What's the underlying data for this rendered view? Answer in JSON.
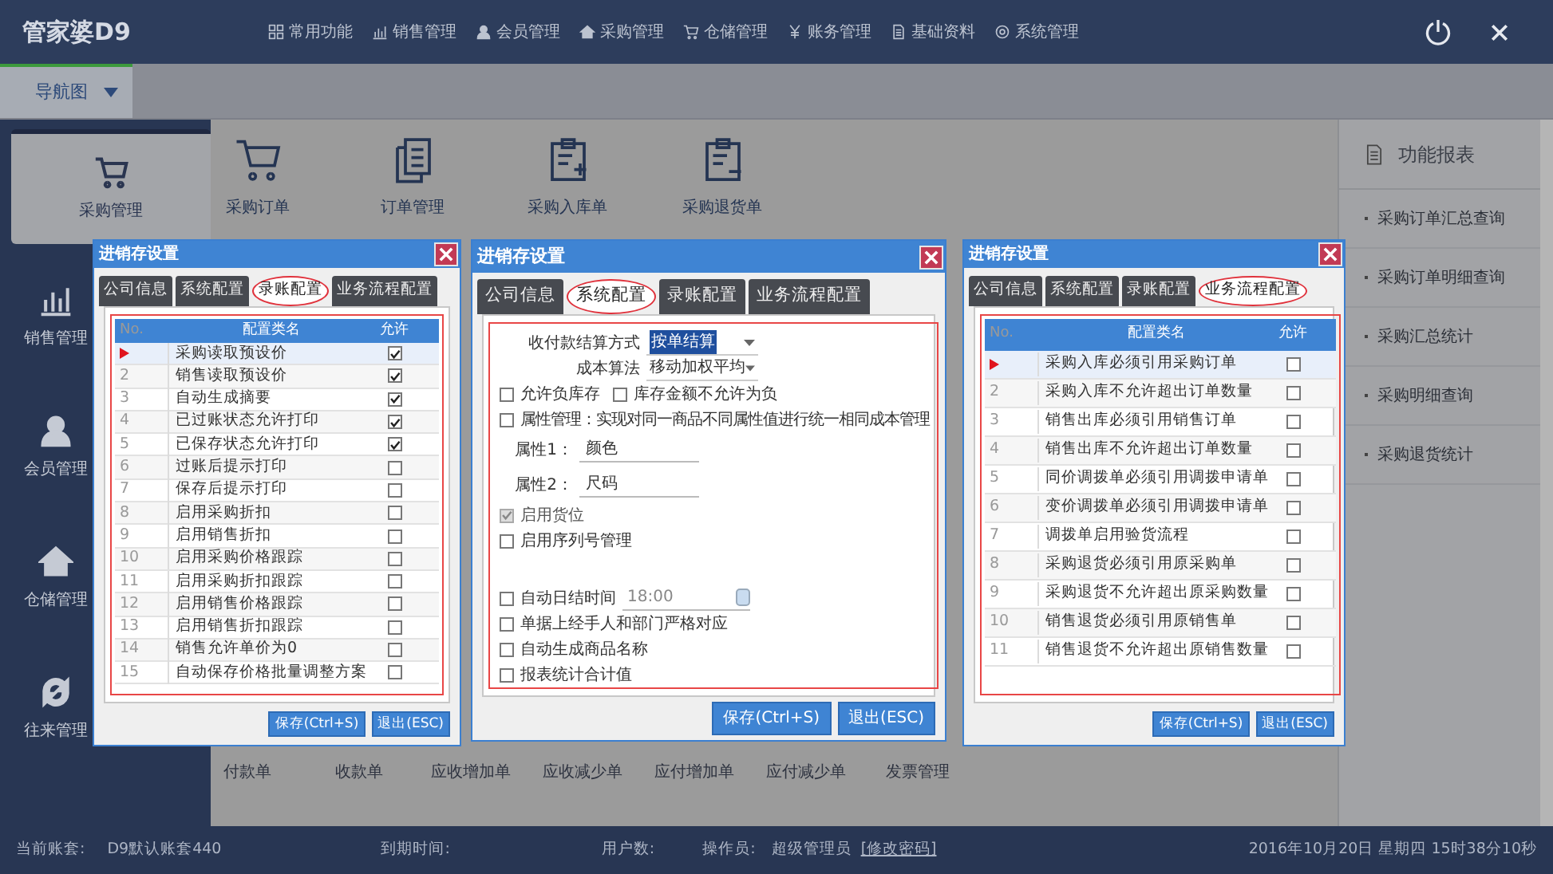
{
  "app": {
    "logo": "管家婆D9",
    "nav_tab": "导航图"
  },
  "menu": [
    {
      "label": "常用功能"
    },
    {
      "label": "销售管理"
    },
    {
      "label": "会员管理"
    },
    {
      "label": "采购管理"
    },
    {
      "label": "仓储管理"
    },
    {
      "label": "账务管理"
    },
    {
      "label": "基础资料"
    },
    {
      "label": "系统管理"
    }
  ],
  "sidebar": [
    {
      "label": "采购管理",
      "selected": true
    },
    {
      "label": "销售管理",
      "selected": false
    },
    {
      "label": "会员管理",
      "selected": false
    },
    {
      "label": "仓储管理",
      "selected": false
    },
    {
      "label": "往来管理",
      "selected": false
    }
  ],
  "toolbar": [
    {
      "label": "采购订单"
    },
    {
      "label": "订单管理"
    },
    {
      "label": "采购入库单"
    },
    {
      "label": "采购退货单"
    }
  ],
  "functions": [
    "付款单",
    "收款单",
    "应收增加单",
    "应收减少单",
    "应付增加单",
    "应付减少单",
    "发票管理"
  ],
  "reports": {
    "title": "功能报表",
    "items": [
      "采购订单汇总查询",
      "采购订单明细查询",
      "采购汇总统计",
      "采购明细查询",
      "采购退货统计"
    ]
  },
  "dialogs": [
    {
      "kind": "grid",
      "title": "进销存设置",
      "tabs": [
        {
          "label": "公司信息",
          "selected": false
        },
        {
          "label": "系统配置",
          "selected": false
        },
        {
          "label": "录账配置",
          "selected": true
        },
        {
          "label": "业务流程配置",
          "selected": false
        }
      ],
      "columns": [
        "No.",
        "配置类名",
        "允许"
      ],
      "rows": [
        {
          "current": true,
          "name": "采购读取预设价",
          "checked": true
        },
        {
          "current": false,
          "no": "2",
          "name": "销售读取预设价",
          "checked": true
        },
        {
          "current": false,
          "no": "3",
          "name": "自动生成摘要",
          "checked": true
        },
        {
          "current": false,
          "no": "4",
          "name": "已过账状态允许打印",
          "checked": true
        },
        {
          "current": false,
          "no": "5",
          "name": "已保存状态允许打印",
          "checked": true
        },
        {
          "current": false,
          "no": "6",
          "name": "过账后提示打印",
          "checked": false
        },
        {
          "current": false,
          "no": "7",
          "name": "保存后提示打印",
          "checked": false
        },
        {
          "current": false,
          "no": "8",
          "name": "启用采购折扣",
          "checked": false
        },
        {
          "current": false,
          "no": "9",
          "name": "启用销售折扣",
          "checked": false
        },
        {
          "current": false,
          "no": "10",
          "name": "启用采购价格跟踪",
          "checked": false
        },
        {
          "current": false,
          "no": "11",
          "name": "启用采购折扣跟踪",
          "checked": false
        },
        {
          "current": false,
          "no": "12",
          "name": "启用销售价格跟踪",
          "checked": false
        },
        {
          "current": false,
          "no": "13",
          "name": "启用销售折扣跟踪",
          "checked": false
        },
        {
          "current": false,
          "no": "14",
          "name": "销售允许单价为0",
          "checked": false
        },
        {
          "current": false,
          "no": "15",
          "name": "自动保存价格批量调整方案",
          "checked": false
        }
      ],
      "buttons": [
        "保存(Ctrl+S)",
        "退出(ESC)"
      ]
    },
    {
      "kind": "form",
      "title": "进销存设置",
      "tabs": [
        {
          "label": "公司信息",
          "selected": false
        },
        {
          "label": "系统配置",
          "selected": true
        },
        {
          "label": "录账配置",
          "selected": false
        },
        {
          "label": "业务流程配置",
          "selected": false
        }
      ],
      "fields": [
        {
          "kind": "select",
          "label": "收付款结算方式",
          "value": "按单结算",
          "highlighted": true
        },
        {
          "kind": "select",
          "label": "成本算法",
          "value": "移动加权平均",
          "highlighted": false
        },
        {
          "kind": "checks",
          "items": [
            {
              "label": "允许负库存",
              "checked": false
            },
            {
              "label": "库存金额不允许为负",
              "checked": false
            }
          ]
        },
        {
          "kind": "check",
          "label": "属性管理：实现对同一商品不同属性值进行统一相同成本管理",
          "checked": false,
          "disabled": false
        },
        {
          "kind": "text",
          "label": "属性1：",
          "value": "颜色"
        },
        {
          "kind": "text",
          "label": "属性2：",
          "value": "尺码"
        },
        {
          "kind": "check",
          "label": "启用货位",
          "checked": true,
          "disabled": true
        },
        {
          "kind": "check",
          "label": "启用序列号管理",
          "checked": false,
          "disabled": false
        },
        {
          "kind": "spacer"
        },
        {
          "kind": "time",
          "label": "自动日结时间",
          "checked": false,
          "value": "18:00"
        },
        {
          "kind": "check",
          "label": "单据上经手人和部门严格对应",
          "checked": false,
          "disabled": false
        },
        {
          "kind": "check",
          "label": "自动生成商品名称",
          "checked": false,
          "disabled": false
        },
        {
          "kind": "check",
          "label": "报表统计合计值",
          "checked": false,
          "disabled": false
        }
      ],
      "buttons": [
        "保存(Ctrl+S)",
        "退出(ESC)"
      ]
    },
    {
      "kind": "grid",
      "title": "进销存设置",
      "tabs": [
        {
          "label": "公司信息",
          "selected": false
        },
        {
          "label": "系统配置",
          "selected": false
        },
        {
          "label": "录账配置",
          "selected": false
        },
        {
          "label": "业务流程配置",
          "selected": true
        }
      ],
      "columns": [
        "No.",
        "配置类名",
        "允许"
      ],
      "rows": [
        {
          "current": true,
          "name": "采购入库必须引用采购订单",
          "checked": false
        },
        {
          "current": false,
          "no": "2",
          "name": "采购入库不允许超出订单数量",
          "checked": false
        },
        {
          "current": false,
          "no": "3",
          "name": "销售出库必须引用销售订单",
          "checked": false
        },
        {
          "current": false,
          "no": "4",
          "name": "销售出库不允许超出订单数量",
          "checked": false
        },
        {
          "current": false,
          "no": "5",
          "name": "同价调拨单必须引用调拨申请单",
          "checked": false
        },
        {
          "current": false,
          "no": "6",
          "name": "变价调拨单必须引用调拨申请单",
          "checked": false
        },
        {
          "current": false,
          "no": "7",
          "name": "调拨单启用验货流程",
          "checked": false
        },
        {
          "current": false,
          "no": "8",
          "name": "采购退货必须引用原采购单",
          "checked": false
        },
        {
          "current": false,
          "no": "9",
          "name": "采购退货不允许超出原采购数量",
          "checked": false
        },
        {
          "current": false,
          "no": "10",
          "name": "销售退货必须引用原销售单",
          "checked": false
        },
        {
          "current": false,
          "no": "11",
          "name": "销售退货不允许超出原销售数量",
          "checked": false
        }
      ],
      "buttons": [
        "保存(Ctrl+S)",
        "退出(ESC)"
      ]
    }
  ],
  "status_bar": {
    "account_label": "当前账套:",
    "account": "D9默认账套440",
    "expire_label": "到期时间:",
    "users_label": "用户数:",
    "operator_label": "操作员:",
    "operator": "超级管理员",
    "change_password": "[修改密码]",
    "datetime": "2016年10月20日 星期四 15时38分10秒"
  }
}
